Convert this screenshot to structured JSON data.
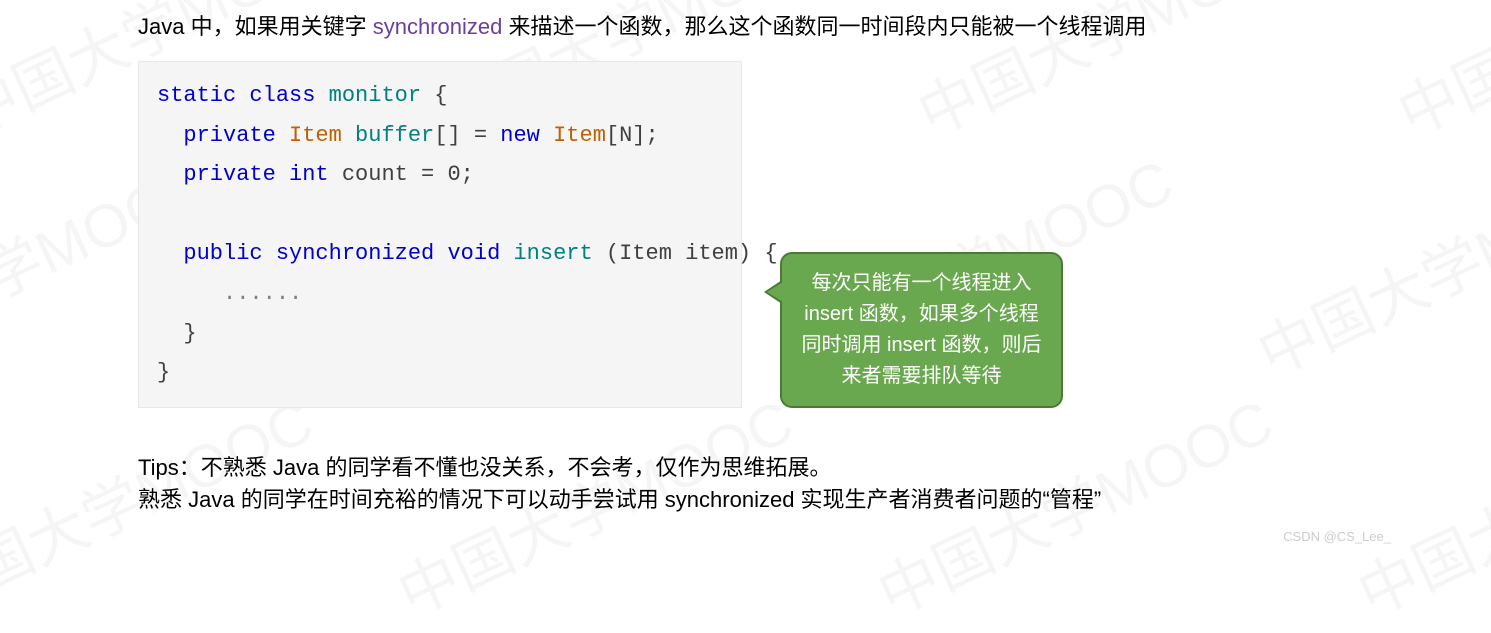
{
  "watermark_text": "中国大学MOOC",
  "intro": {
    "part1": "Java 中，如果用关键字 ",
    "keyword": "synchronized",
    "part2": " 来描述一个函数，那么这个函数同一时间段内只能被一个线程调用"
  },
  "code": {
    "l1_kw1": "static",
    "l1_kw2": "class",
    "l1_name": "monitor",
    "l1_brace": " {",
    "l2_kw": "private",
    "l2_type": "Item",
    "l2_var": "buffer",
    "l2_rest1": "[] = ",
    "l2_new": "new",
    "l2_type2": " Item",
    "l2_rest2": "[N];",
    "l3_kw": "private",
    "l3_type": "int",
    "l3_var": " count = 0;",
    "l4_kw1": "public",
    "l4_kw2": "synchronized",
    "l4_kw3": "void",
    "l4_fn": "insert",
    "l4_params": " (Item item) {",
    "l5_dots": "......",
    "l6_brace": "}",
    "l7_brace": "}"
  },
  "annotation": "每次只能有一个线程进入 insert 函数，如果多个线程同时调用 insert 函数，则后来者需要排队等待",
  "tips": {
    "line1": "Tips：不熟悉 Java 的同学看不懂也没关系，不会考，仅作为思维拓展。",
    "line2": "熟悉 Java 的同学在时间充裕的情况下可以动手尝试用 synchronized 实现生产者消费者问题的“管程”"
  },
  "footer": "CSDN @CS_Lee_"
}
